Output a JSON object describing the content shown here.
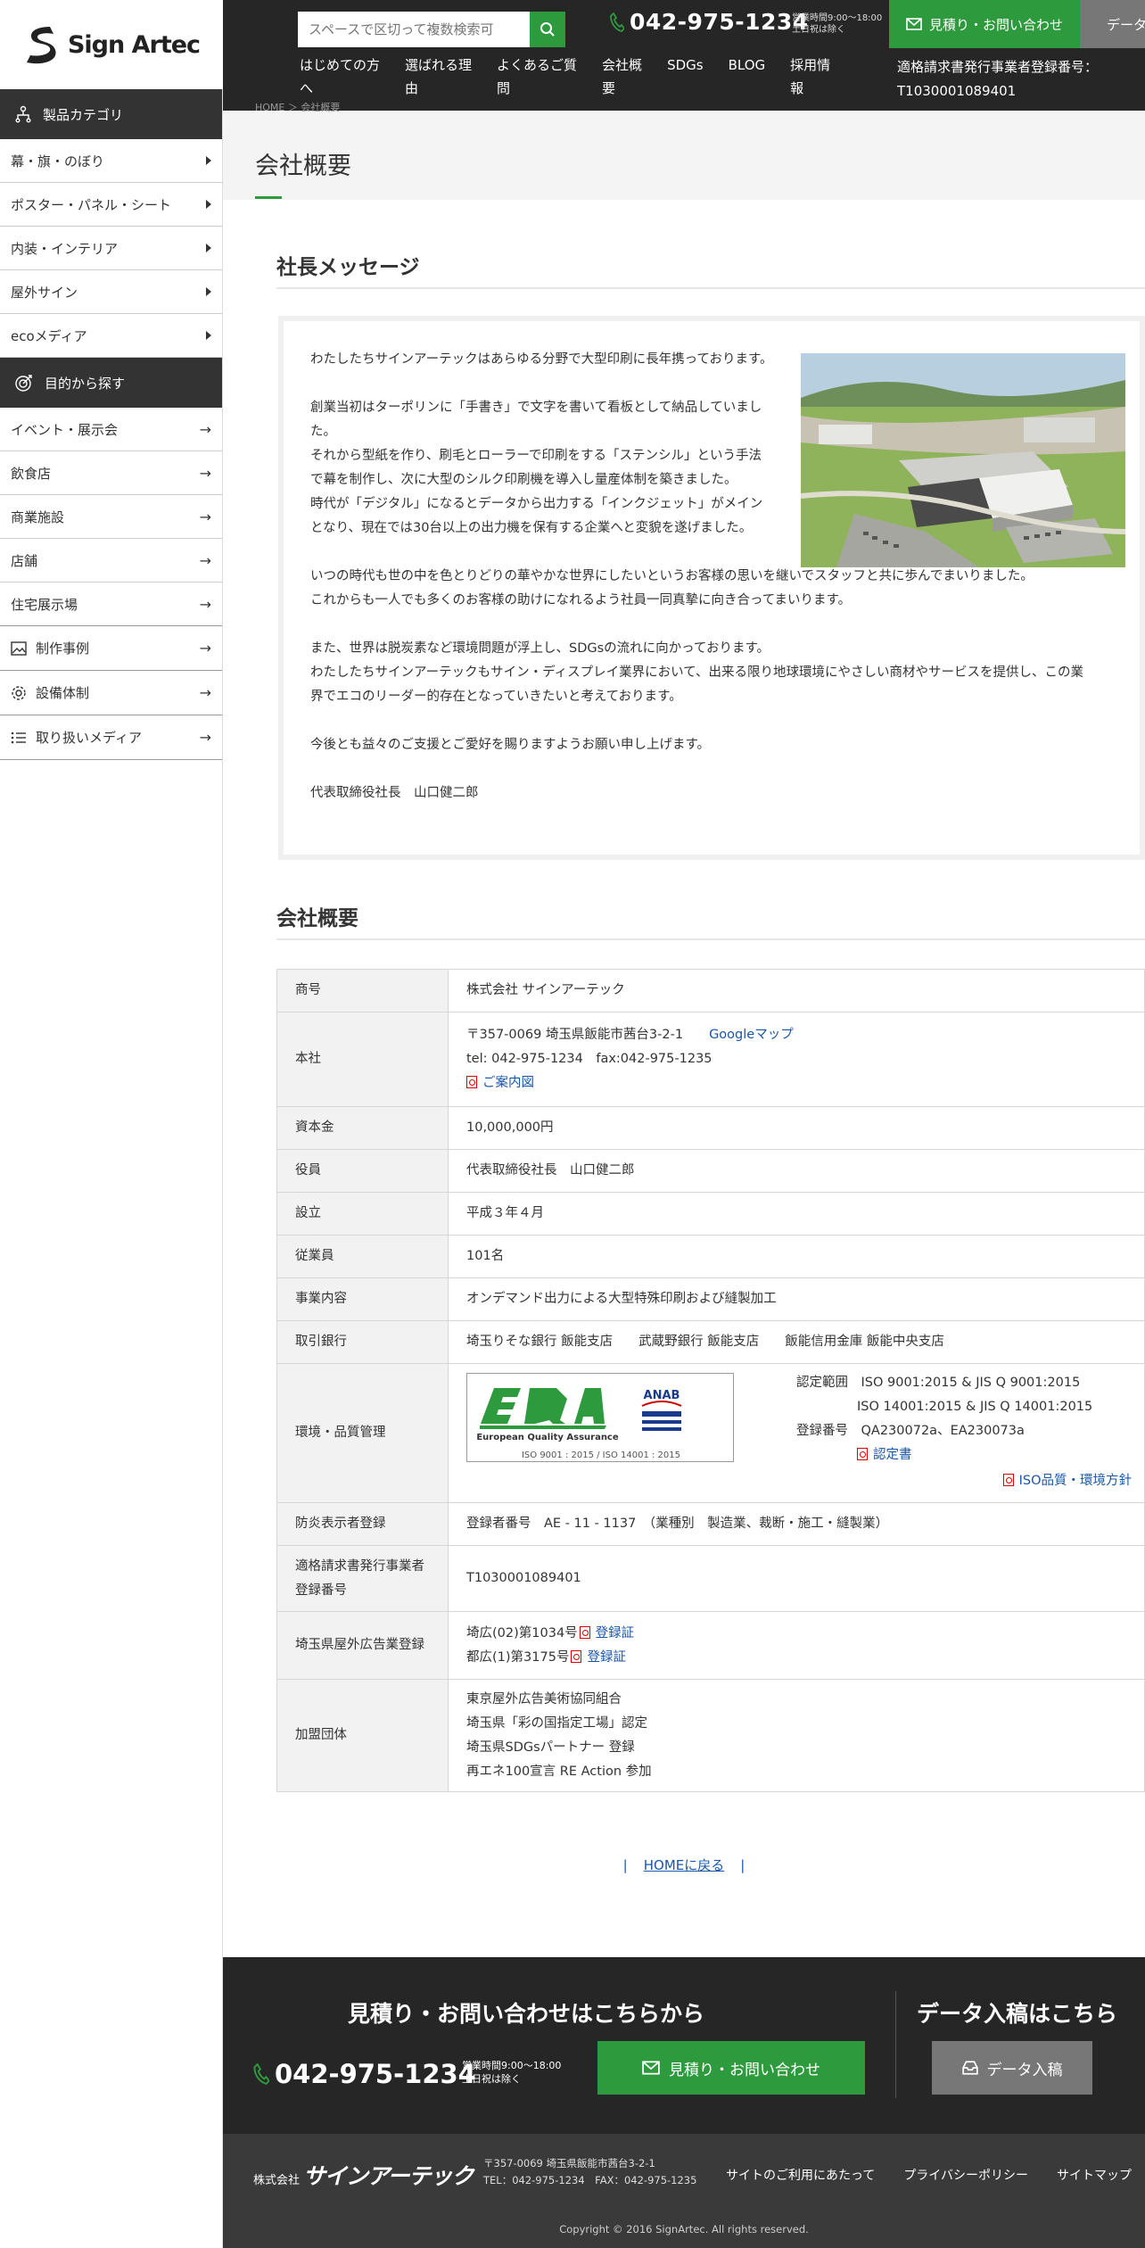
{
  "header": {
    "brand": "Sign Artec",
    "search_placeholder": "スペースで区切って複数検索可",
    "phone": "042-975-1234",
    "hours_line1": "営業時間9:00～18:00",
    "hours_line2": "土日祝は除く",
    "estimate_label": "見積り・お問い合わせ",
    "data_label": "データ入稿",
    "nav": [
      {
        "line1": "はじめての方",
        "line2": "へ"
      },
      {
        "line1": "選ばれる理",
        "line2": "由"
      },
      {
        "line1": "よくあるご質",
        "line2": "問"
      },
      {
        "line1": "会社概",
        "line2": "要"
      },
      {
        "line1": "SDGs",
        "line2": ""
      },
      {
        "line1": "BLOG",
        "line2": ""
      },
      {
        "line1": "採用情",
        "line2": "報"
      }
    ],
    "invoice_line1": "適格請求書発行事業者登録番号：",
    "invoice_line2": "T1030001089401"
  },
  "sidebar": {
    "product_head": "製品カテゴリ",
    "products": [
      "幕・旗・のぼり",
      "ポスター・パネル・シート",
      "内装・インテリア",
      "屋外サイン",
      "ecoメディア"
    ],
    "purpose_head": "目的から探す",
    "purposes": [
      "イベント・展示会",
      "飲食店",
      "商業施設",
      "店舗",
      "住宅展示場"
    ],
    "extras": [
      "制作事例",
      "設備体制",
      "取り扱いメディア"
    ]
  },
  "main": {
    "breadcrumb": "HOME ＞ 会社概要",
    "page_title": "会社概要",
    "message_title": "社長メッセージ",
    "message_paragraphs": [
      "わたしたちサインアーテックはあらゆる分野で大型印刷に長年携っております。",
      "創業当初はターポリンに「手書き」で文字を書いて看板として納品していました。\nそれから型紙を作り、刷毛とローラーで印刷をする「ステンシル」という手法で幕を制作し、次に大型のシルク印刷機を導入し量産体制を築きました。\n時代が「デジタル」になるとデータから出力する「インクジェット」がメインとなり、現在では30台以上の出力機を保有する企業へと変貌を遂げました。",
      "いつの時代も世の中を色とりどりの華やかな世界にしたいというお客様の思いを継いでスタッフと共に歩んでまいりました。\nこれからも一人でも多くのお客様の助けになれるよう社員一同真摯に向き合ってまいります。",
      "また、世界は脱炭素など環境問題が浮上し、SDGsの流れに向かっております。\nわたしたちサインアーテックもサイン・ディスプレイ業界において、出来る限り地球環境にやさしい商材やサービスを提供し、この業界でエコのリーダー的存在となっていきたいと考えております。",
      "今後とも益々のご支援とご愛好を賜りますようお願い申し上げます。",
      "代表取締役社長　山口健二郎"
    ],
    "overview_title": "会社概要",
    "table": {
      "trade_name_label": "商号",
      "trade_name": "株式会社 サインアーテック",
      "hq_label": "本社",
      "hq_address": "〒357-0069 埼玉県飯能市茜台3-2-1",
      "hq_map": "Googleマップ",
      "hq_tel": "tel: 042-975-1234　fax:042-975-1235",
      "hq_guide": "ご案内図",
      "capital_label": "資本金",
      "capital": "10,000,000円",
      "officer_label": "役員",
      "officer": "代表取締役社長　山口健二郎",
      "founded_label": "設立",
      "founded": "平成３年４月",
      "employees_label": "従業員",
      "employees": "101名",
      "business_label": "事業内容",
      "business": "オンデマンド出力による大型特殊印刷および縫製加工",
      "bank_label": "取引銀行",
      "bank": "埼玉りそな銀行 飯能支店　　武蔵野銀行 飯能支店　　飯能信用金庫 飯能中央支店",
      "quality_label": "環境・品質管理",
      "cert_logo_text": "European Quality Assurance",
      "cert_logo_sub": "ISO 9001 : 2015 / ISO 14001 : 2015",
      "cert_anab": "ANAB",
      "scope_label": "認定範囲",
      "scope1": "ISO 9001:2015 & JIS Q 9001:2015",
      "scope2": "ISO 14001:2015 & JIS Q 14001:2015",
      "reg_label": "登録番号",
      "reg_no": "QA230072a、EA230073a",
      "cert_doc": "認定書",
      "iso_policy": "ISO品質・環境方針",
      "fire_label": "防炎表示者登録",
      "fire": "登録者番号　AE - 11 - 1137　（業種別　製造業、裁断・施工・縫製業）",
      "invoice_label_line1": "適格請求書発行事業者",
      "invoice_label_line2": "登録番号",
      "invoice": "T1030001089401",
      "outdoor_label": "埼玉県屋外広告業登録",
      "outdoor1": "埼広(02)第1034号",
      "outdoor2": "都広(1)第3175号",
      "outdoor_cert": "登録証",
      "member_label": "加盟団体",
      "members": [
        "東京屋外広告美術協同組合",
        "埼玉県「彩の国指定工場」認定",
        "埼玉県SDGsパートナー 登録",
        "再エネ100宣言 RE Action 参加"
      ]
    },
    "home_link": "HOMEに戻る"
  },
  "cta": {
    "title": "見積り・お問い合わせはこちらから",
    "phone": "042-975-1234",
    "hours_line1": "営業時間9:00～18:00",
    "hours_line2": "土日祝は除く",
    "estimate_label": "見積り・お問い合わせ",
    "data_title": "データ入稿はこちら",
    "data_label": "データ入稿"
  },
  "footer": {
    "company_prefix": "株式会社",
    "company_name": "サインアーテック",
    "address": "〒357-0069 埼玉県飯能市茜台3-2-1",
    "telfax": "TEL：042-975-1234　FAX：042-975-1235",
    "links": [
      "サイトのご利用にあたって",
      "プライバシーポリシー",
      "サイトマップ"
    ],
    "copyright": "Copyright © 2016 SignArtec. All rights reserved."
  },
  "colors": {
    "accent": "#2e9a3e",
    "dark": "#262626",
    "link": "#1a56a8",
    "pdf": "#dd0000"
  }
}
